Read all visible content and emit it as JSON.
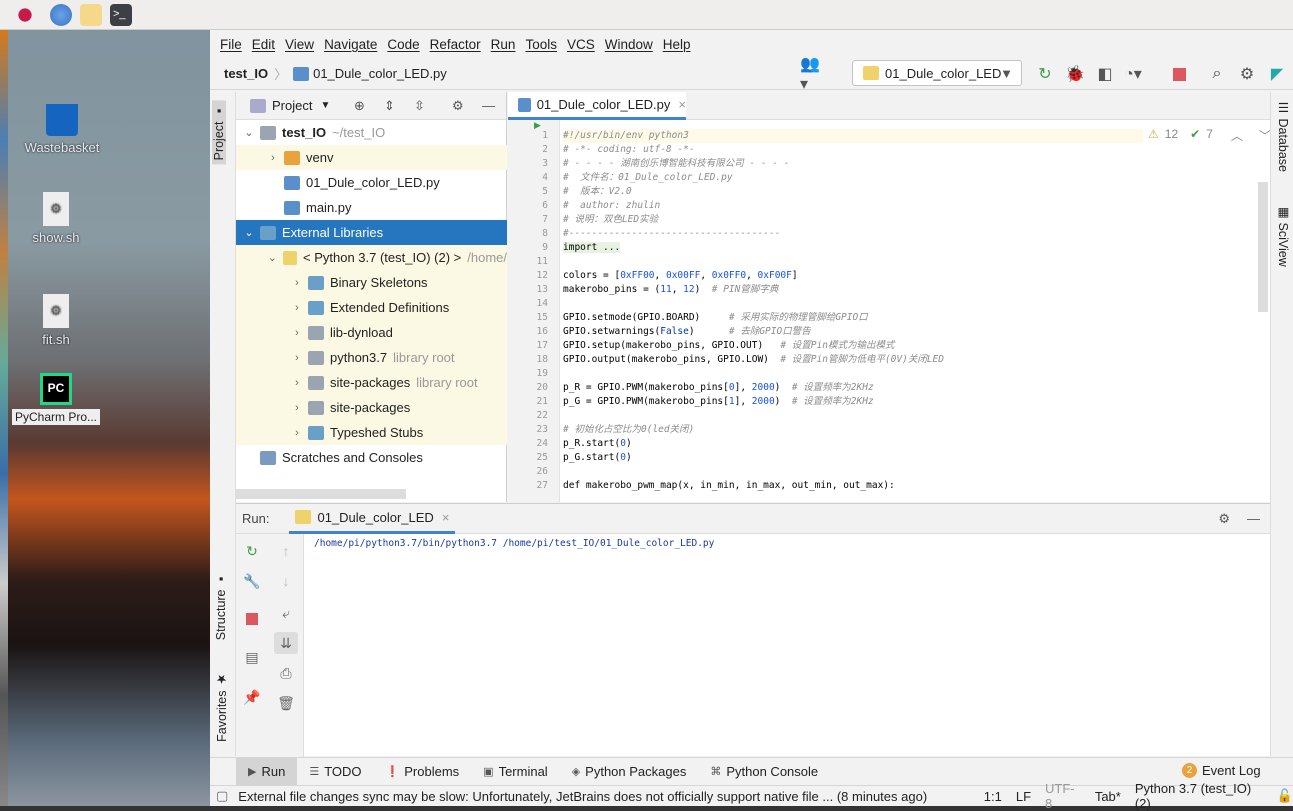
{
  "desktop": {
    "icons": [
      {
        "label": "Wastebasket"
      },
      {
        "label": "show.sh"
      },
      {
        "label": "fit.sh"
      },
      {
        "label": "PyCharm Pro..."
      }
    ]
  },
  "menu": [
    "File",
    "Edit",
    "View",
    "Navigate",
    "Code",
    "Refactor",
    "Run",
    "Tools",
    "VCS",
    "Window",
    "Help"
  ],
  "nav": {
    "project": "test_IO",
    "file": "01_Dule_color_LED.py"
  },
  "run_config": "01_Dule_color_LED",
  "left_tools": {
    "project": "Project",
    "structure": "Structure",
    "favorites": "Favorites"
  },
  "right_tools": {
    "database": "Database",
    "sciview": "SciView"
  },
  "project_panel": {
    "title": "Project",
    "tree": [
      {
        "label": "test_IO",
        "extra": "~/test_IO",
        "bold": true,
        "chev": "⌄",
        "indent": 0,
        "icon": "folder"
      },
      {
        "label": "venv",
        "chev": "›",
        "indent": 1,
        "icon": "folder-orange",
        "hl": true
      },
      {
        "label": "01_Dule_color_LED.py",
        "indent": 1,
        "icon": "python-file"
      },
      {
        "label": "main.py",
        "indent": 1,
        "icon": "python-file"
      },
      {
        "label": "External Libraries",
        "chev": "⌄",
        "indent": 0,
        "icon": "library",
        "sel": true
      },
      {
        "label": "< Python 3.7 (test_IO) (2) >",
        "extra": "/home/",
        "chev": "⌄",
        "indent": 1,
        "icon": "python",
        "hl": true
      },
      {
        "label": "Binary Skeletons",
        "chev": "›",
        "indent": 2,
        "icon": "library",
        "hl": true
      },
      {
        "label": "Extended Definitions",
        "chev": "›",
        "indent": 2,
        "icon": "library",
        "hl": true
      },
      {
        "label": "lib-dynload",
        "chev": "›",
        "indent": 2,
        "icon": "folder",
        "hl": true
      },
      {
        "label": "python3.7",
        "extra": "library root",
        "chev": "›",
        "indent": 2,
        "icon": "folder",
        "hl": true
      },
      {
        "label": "site-packages",
        "extra": "library root",
        "chev": "›",
        "indent": 2,
        "icon": "folder",
        "hl": true
      },
      {
        "label": "site-packages",
        "chev": "›",
        "indent": 2,
        "icon": "folder",
        "hl": true
      },
      {
        "label": "Typeshed Stubs",
        "chev": "›",
        "indent": 2,
        "icon": "library",
        "hl": true
      },
      {
        "label": "Scratches and Consoles",
        "indent": 0,
        "icon": "scratches"
      }
    ]
  },
  "editor": {
    "tab": "01_Dule_color_LED.py",
    "warnings": "12",
    "checks": "7",
    "lines": [
      {
        "n": "1",
        "t": [
          [
            "#!/usr/bin/env python3",
            "cm"
          ]
        ]
      },
      {
        "n": "2",
        "t": [
          [
            "# -*- coding: utf-8 -*-",
            "cm"
          ]
        ]
      },
      {
        "n": "3",
        "t": [
          [
            "# - - - - 湖南创乐博智能科技有限公司 - - - -",
            "cm"
          ]
        ]
      },
      {
        "n": "4",
        "t": [
          [
            "#  文件名：01_Dule_color_LED.py",
            "cm"
          ]
        ]
      },
      {
        "n": "5",
        "t": [
          [
            "#  版本：V2.0",
            "cm"
          ]
        ]
      },
      {
        "n": "6",
        "t": [
          [
            "#  author: zhulin",
            "cm"
          ]
        ]
      },
      {
        "n": "7",
        "t": [
          [
            "# 说明：双色LED实验",
            "cm"
          ]
        ]
      },
      {
        "n": "8",
        "t": [
          [
            "#-------------------------------------",
            "cm"
          ]
        ]
      },
      {
        "n": "9",
        "t": [
          [
            "import ...",
            ""
          ]
        ]
      },
      {
        "n": "11",
        "t": []
      },
      {
        "n": "12",
        "t": [
          [
            "colors = [",
            ""
          ],
          [
            "0xFF00",
            "num"
          ],
          [
            ", ",
            ""
          ],
          [
            "0x00FF",
            "num"
          ],
          [
            ", ",
            ""
          ],
          [
            "0x0FF0",
            "num"
          ],
          [
            ", ",
            ""
          ],
          [
            "0xF00F",
            "num"
          ],
          [
            "]",
            ""
          ]
        ]
      },
      {
        "n": "13",
        "t": [
          [
            "makerobo_pins = (",
            ""
          ],
          [
            "11",
            "num"
          ],
          [
            ", ",
            ""
          ],
          [
            "12",
            "num"
          ],
          [
            ")  ",
            ""
          ],
          [
            "# PIN管脚字典",
            "cm"
          ]
        ]
      },
      {
        "n": "14",
        "t": []
      },
      {
        "n": "15",
        "t": [
          [
            "GPIO.setmode(GPIO.BOARD)     ",
            ""
          ],
          [
            "# 采用实际的物理管脚给GPIO口",
            "cm"
          ]
        ]
      },
      {
        "n": "16",
        "t": [
          [
            "GPIO.setwarnings(",
            ""
          ],
          [
            "False",
            "kw"
          ],
          [
            ")      ",
            ""
          ],
          [
            "# 去除GPIO口警告",
            "cm"
          ]
        ]
      },
      {
        "n": "17",
        "t": [
          [
            "GPIO.setup(makerobo_pins, GPIO.OUT)   ",
            ""
          ],
          [
            "# 设置Pin模式为输出模式",
            "cm"
          ]
        ]
      },
      {
        "n": "18",
        "t": [
          [
            "GPIO.output(makerobo_pins, GPIO.LOW)  ",
            ""
          ],
          [
            "# 设置Pin管脚为低电平(0V)关闭LED",
            "cm"
          ]
        ]
      },
      {
        "n": "19",
        "t": []
      },
      {
        "n": "20",
        "t": [
          [
            "p_R = GPIO.PWM(makerobo_pins[",
            ""
          ],
          [
            "0",
            "num"
          ],
          [
            "], ",
            ""
          ],
          [
            "2000",
            "num"
          ],
          [
            ")  ",
            ""
          ],
          [
            "# 设置频率为2KHz",
            "cm"
          ]
        ]
      },
      {
        "n": "21",
        "t": [
          [
            "p_G = GPIO.PWM(makerobo_pins[",
            ""
          ],
          [
            "1",
            "num"
          ],
          [
            "], ",
            ""
          ],
          [
            "2000",
            "num"
          ],
          [
            ")  ",
            ""
          ],
          [
            "# 设置频率为2KHz",
            "cm"
          ]
        ]
      },
      {
        "n": "22",
        "t": []
      },
      {
        "n": "23",
        "t": [
          [
            "# 初始化占空比为0(led关闭)",
            "cm"
          ]
        ]
      },
      {
        "n": "24",
        "t": [
          [
            "p_R.start(",
            ""
          ],
          [
            "0",
            "num"
          ],
          [
            ")",
            ""
          ]
        ]
      },
      {
        "n": "25",
        "t": [
          [
            "p_G.start(",
            ""
          ],
          [
            "0",
            "num"
          ],
          [
            ")",
            ""
          ]
        ]
      },
      {
        "n": "26",
        "t": []
      },
      {
        "n": "27",
        "t": [
          [
            "def makerobo_pwm_map(x, in_min, in_max, out_min, out_max):",
            ""
          ]
        ]
      }
    ]
  },
  "run": {
    "label": "Run:",
    "tab": "01_Dule_color_LED",
    "output": "/home/pi/python3.7/bin/python3.7 /home/pi/test_IO/01_Dule_color_LED.py"
  },
  "bottom_tabs": [
    {
      "icon": "run-icon",
      "label": "Run"
    },
    {
      "icon": "list-icon",
      "label": "TODO"
    },
    {
      "icon": "problems-icon",
      "label": "Problems"
    },
    {
      "icon": "terminal-icon",
      "label": "Terminal"
    },
    {
      "icon": "packages-icon",
      "label": "Python Packages"
    },
    {
      "icon": "python-console-icon",
      "label": "Python Console"
    }
  ],
  "event_log": {
    "count": "2",
    "label": "Event Log"
  },
  "status": {
    "message": "External file changes sync may be slow: Unfortunately, JetBrains does not officially support native file ... (8 minutes ago)",
    "position": "1:1",
    "line_sep": "LF",
    "encoding": "UTF-8",
    "indent": "Tab*",
    "interpreter": "Python 3.7 (test_IO) (2)"
  },
  "colors": {
    "accent": "#2675bf",
    "run_green": "#3e9e4a",
    "stop_red": "#db5860",
    "highlight": "#fbf9e3"
  }
}
